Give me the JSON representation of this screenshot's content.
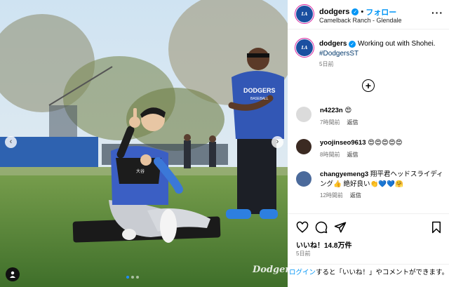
{
  "account": {
    "username": "dodgers",
    "follow_label": "フォロー",
    "location": "Camelback Ranch - Glendale",
    "separator": "•"
  },
  "caption": {
    "username": "dodgers",
    "text": "Working out with Shohei.",
    "hashtag": "#DodgersST",
    "time": "5日前"
  },
  "comments": [
    {
      "username": "n4223n",
      "text": "😍",
      "time": "7時間前",
      "reply_label": "返信"
    },
    {
      "username": "yoojinseo9613",
      "text": "😍😍😍😍😍",
      "time": "8時間前",
      "reply_label": "返信"
    },
    {
      "username": "changyemeng3",
      "text": "翔平君ヘッドスライディング👍 絶好良い👏💙💙🤗",
      "time": "12時間前",
      "reply_label": "返信"
    }
  ],
  "stats": {
    "likes": "いいね！14.8万件",
    "posted": "5日前"
  },
  "login_prompt": {
    "link": "ログイン",
    "text": "すると「いいね！」やコメントができます。"
  },
  "photo": {
    "watermark": "Dodgers",
    "prev_glyph": "‹",
    "next_glyph": "›",
    "jersey_text": "DODGERS",
    "jersey_sub": "BASEBALL"
  },
  "colors": {
    "accent_blue": "#0095f6",
    "dodger_blue": "#1a4fa0",
    "grass": "#5a8c3c"
  }
}
